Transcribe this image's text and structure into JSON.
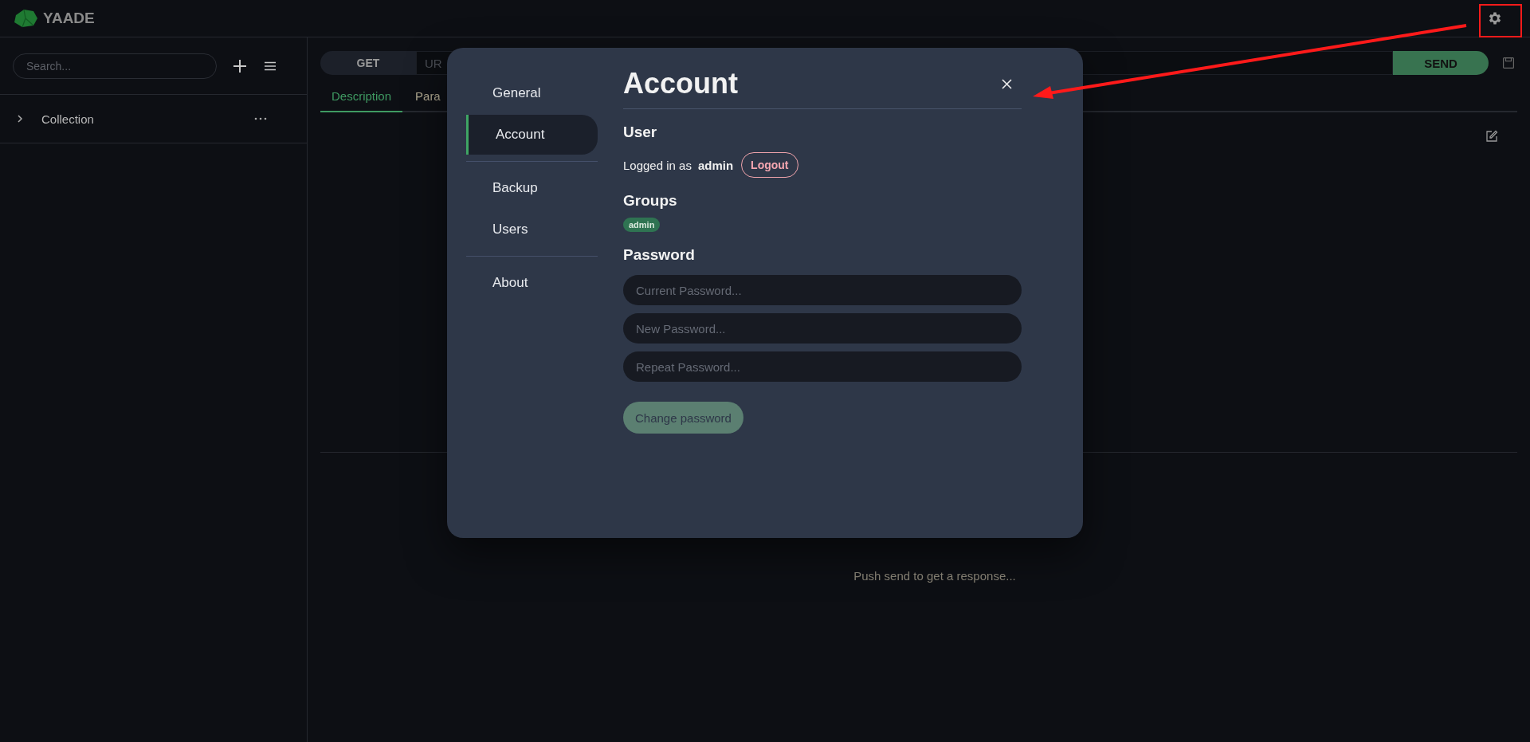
{
  "header": {
    "app_name": "YAADE"
  },
  "sidebar": {
    "search": {
      "placeholder": "Search..."
    },
    "collections": [
      {
        "name": "Collection",
        "expanded": false
      }
    ]
  },
  "request": {
    "method": "GET",
    "url": {
      "placeholder": "UR"
    },
    "send": "SEND",
    "tabs": [
      {
        "label": "Description",
        "selected": true
      },
      {
        "label": "Para",
        "selected": false
      }
    ]
  },
  "response": {
    "message": "Push send to get a response..."
  },
  "settings": {
    "nav_groups": [
      {
        "items": [
          {
            "label": "General",
            "selected": false
          },
          {
            "label": "Account",
            "selected": true
          }
        ]
      },
      {
        "items": [
          {
            "label": "Backup",
            "selected": false
          },
          {
            "label": "Users",
            "selected": false
          }
        ]
      },
      {
        "items": [
          {
            "label": "About",
            "selected": false
          }
        ]
      }
    ],
    "title": "Account",
    "user": {
      "heading": "User",
      "logged_in_label": "Logged in as",
      "username": "admin",
      "logout": "Logout"
    },
    "groups": {
      "heading": "Groups",
      "items": [
        "admin"
      ]
    },
    "password": {
      "heading": "Password",
      "fields": [
        {
          "placeholder": "Current Password..."
        },
        {
          "placeholder": "New Password..."
        },
        {
          "placeholder": "Repeat Password..."
        }
      ],
      "submit": "Change password"
    }
  }
}
